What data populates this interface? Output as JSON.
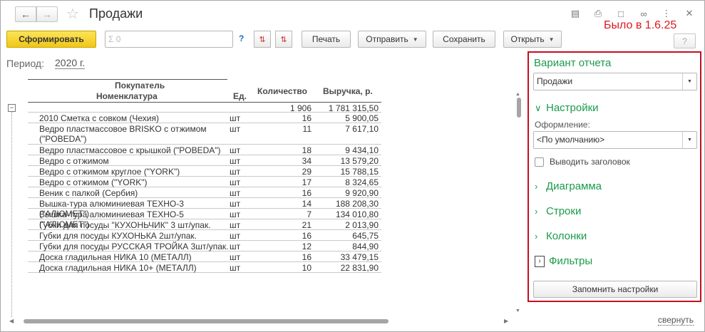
{
  "window": {
    "title": "Продажи",
    "version_note": "Было в 1.6.25",
    "icons": [
      "print-preview-icon",
      "printer-icon",
      "minimize-icon",
      "link-icon",
      "more-icon",
      "close-icon"
    ]
  },
  "toolbar": {
    "generate_label": "Сформировать",
    "search_placeholder": "Σ 0",
    "help_label": "?",
    "print_label": "Печать",
    "send_label": "Отправить",
    "save_label": "Сохранить",
    "open_label": "Открыть",
    "help_btn_label": "?"
  },
  "period": {
    "label": "Период:",
    "value": "2020 г."
  },
  "report": {
    "headers": {
      "buyer": "Покупатель",
      "nomenclature": "Номенклатура",
      "unit": "Ед.",
      "quantity": "Количество",
      "revenue": "Выручка, р."
    },
    "total": {
      "qty": "1 906",
      "revenue": "1 781 315,50"
    },
    "rows": [
      {
        "name": "2010 Сметка с совком (Чехия)",
        "unit": "шт",
        "qty": "16",
        "revenue": "5 900,05"
      },
      {
        "name": "Ведро пластмассовое BRISKO с отжимом (\"POBEDA\")",
        "unit": "шт",
        "qty": "11",
        "revenue": "7 617,10"
      },
      {
        "name": "Ведро пластмассовое с крышкой (\"POBEDA\")",
        "unit": "шт",
        "qty": "18",
        "revenue": "9 434,10"
      },
      {
        "name": "Ведро с отжимом",
        "unit": "шт",
        "qty": "34",
        "revenue": "13 579,20"
      },
      {
        "name": "Ведро с отжимом  круглое (\"YORK\")",
        "unit": "шт",
        "qty": "29",
        "revenue": "15 788,15"
      },
      {
        "name": "Ведро с отжимом (\"YORK\")",
        "unit": "шт",
        "qty": "17",
        "revenue": "8 324,65"
      },
      {
        "name": "Веник с палкой (Сербия)",
        "unit": "шт",
        "qty": "16",
        "revenue": "9 920,90"
      },
      {
        "name": "Вышка-тура алюминиевая ТЕХНО-3 (\"АЛЮМЕТ\")",
        "unit": "шт",
        "qty": "14",
        "revenue": "188 208,30"
      },
      {
        "name": "Вышка-тура алюминиевая ТЕХНО-5 (\"АЛЮМЕТ\")",
        "unit": "шт",
        "qty": "7",
        "revenue": "134 010,80"
      },
      {
        "name": "Губки для посуды \"КУХОНЬЧИК\" 3 шт/упак.",
        "unit": "шт",
        "qty": "21",
        "revenue": "2 013,90"
      },
      {
        "name": "Губки для посуды КУХОНЬКА 2шт/упак.",
        "unit": "шт",
        "qty": "16",
        "revenue": "645,75"
      },
      {
        "name": "Губки для посуды РУССКАЯ ТРОЙКА 3шт/упак.",
        "unit": "шт",
        "qty": "12",
        "revenue": "844,90"
      },
      {
        "name": "Доска гладильная  НИКА 10 (МЕТАЛЛ)",
        "unit": "шт",
        "qty": "16",
        "revenue": "33 479,15"
      },
      {
        "name": "Доска гладильная  НИКА 10+ (МЕТАЛЛ)",
        "unit": "шт",
        "qty": "10",
        "revenue": "22 831,90"
      }
    ],
    "collapse_label": "свернуть"
  },
  "panel": {
    "title": "Вариант отчета",
    "variant_value": "Продажи",
    "settings_label": "Настройки",
    "design_label": "Оформление:",
    "design_value": "<По умолчанию>",
    "show_title_label": "Выводить заголовок",
    "sections": [
      "Диаграмма",
      "Строки",
      "Колонки",
      "Фильтры"
    ],
    "save_settings_label": "Запомнить настройки"
  },
  "colors": {
    "accent_green": "#1a9b4b",
    "highlight_red": "#c50f1f",
    "primary_yellow": "#f1c716"
  }
}
